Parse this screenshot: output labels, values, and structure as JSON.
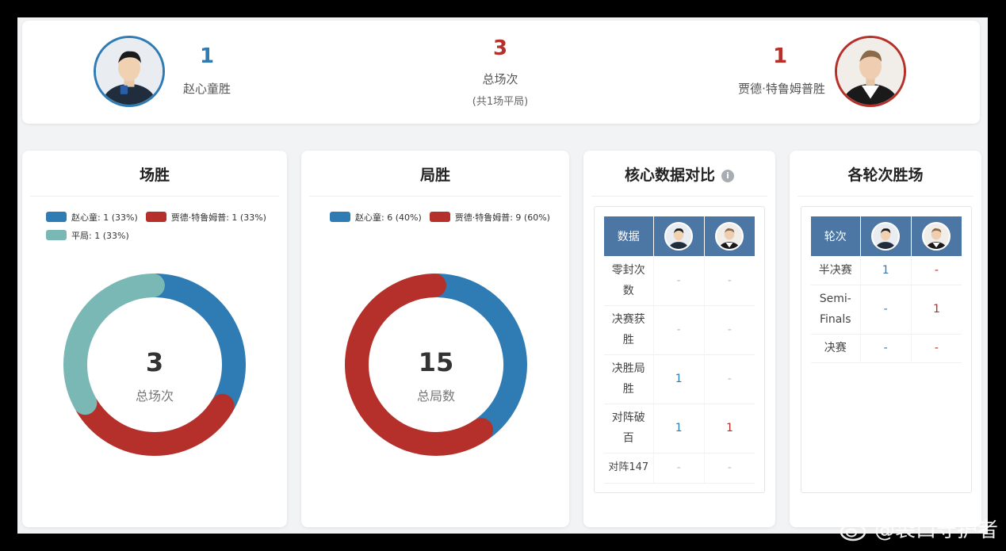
{
  "summary": {
    "left_player_wins": "1",
    "left_player_label": "赵心童胜",
    "total_matches": "3",
    "total_label": "总场次",
    "total_sub": "(共1场平局)",
    "right_player_wins": "1",
    "right_player_label": "贾德·特鲁姆普胜"
  },
  "colors": {
    "blue": "#2f7bb4",
    "red": "#b5302a",
    "teal": "#79b8b4"
  },
  "match_card": {
    "title": "场胜",
    "legend": [
      "赵心童: 1 (33%)",
      "贾德·特鲁姆普: 1 (33%)",
      "平局: 1 (33%)"
    ],
    "center_value": "3",
    "center_label": "总场次"
  },
  "frame_card": {
    "title": "局胜",
    "legend": [
      "赵心童: 6 (40%)",
      "贾德·特鲁姆普: 9 (60%)"
    ],
    "center_value": "15",
    "center_label": "总局数"
  },
  "core_card": {
    "title": "核心数据对比",
    "info_icon": "i",
    "header": "数据",
    "rows": [
      {
        "label": "零封次数",
        "left": "-",
        "right": "-"
      },
      {
        "label": "决赛获胜",
        "left": "-",
        "right": "-"
      },
      {
        "label": "决胜局胜",
        "left": "1",
        "right": "-"
      },
      {
        "label": "对阵破百",
        "left": "1",
        "right": "1"
      },
      {
        "label": "对阵147",
        "left": "-",
        "right": "-"
      }
    ]
  },
  "round_card": {
    "title": "各轮次胜场",
    "header": "轮次",
    "rows": [
      {
        "label": "半决赛",
        "left": "1",
        "right": "-"
      },
      {
        "label": "Semi-Finals",
        "left": "-",
        "right": "1"
      },
      {
        "label": "决赛",
        "left": "-",
        "right": "-"
      }
    ]
  },
  "chart_data": [
    {
      "type": "pie",
      "title": "场胜",
      "categories": [
        "赵心童",
        "贾德·特鲁姆普",
        "平局"
      ],
      "values": [
        1,
        1,
        1
      ],
      "percent": [
        33,
        33,
        33
      ],
      "total": 3
    },
    {
      "type": "pie",
      "title": "局胜",
      "categories": [
        "赵心童",
        "贾德·特鲁姆普"
      ],
      "values": [
        6,
        9
      ],
      "percent": [
        40,
        60
      ],
      "total": 15
    }
  ],
  "watermark": "@袋口守护者"
}
